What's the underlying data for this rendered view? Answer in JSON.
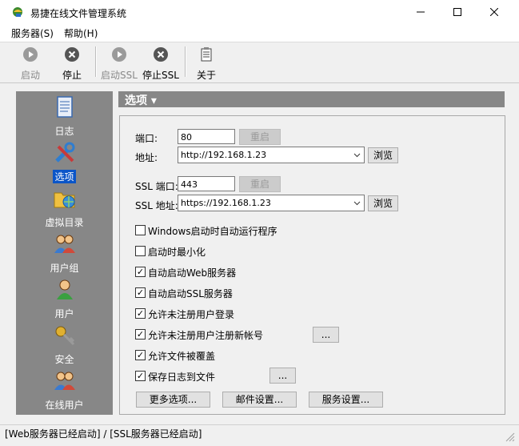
{
  "window": {
    "title": "易捷在线文件管理系统"
  },
  "menu": {
    "items": [
      {
        "label": "服务器(S)"
      },
      {
        "label": "帮助(H)"
      }
    ]
  },
  "toolbar": {
    "start": "启动",
    "stop": "停止",
    "start_ssl": "启动SSL",
    "stop_ssl": "停止SSL",
    "about": "关于"
  },
  "nav": {
    "items": [
      {
        "label": "日志"
      },
      {
        "label": "选项",
        "selected": true
      },
      {
        "label": "虚拟目录"
      },
      {
        "label": "用户组"
      },
      {
        "label": "用户"
      },
      {
        "label": "安全"
      },
      {
        "label": "在线用户"
      }
    ]
  },
  "options": {
    "header": "选项 ▾",
    "port_label": "端口:",
    "port_value": "80",
    "restart": "重启",
    "address_label": "地址:",
    "address_value": "http://192.168.1.23",
    "browse": "浏览",
    "ssl_port_label": "SSL 端口:",
    "ssl_port_value": "443",
    "ssl_address_label": "SSL 地址:",
    "ssl_address_value": "https://192.168.1.23",
    "checkboxes": [
      {
        "label": "Windows启动时自动运行程序",
        "checked": false
      },
      {
        "label": "启动时最小化",
        "checked": false
      },
      {
        "label": "自动启动Web服务器",
        "checked": true
      },
      {
        "label": "自动启动SSL服务器",
        "checked": true
      },
      {
        "label": "允许未注册用户登录",
        "checked": true
      },
      {
        "label": "允许未注册用户注册新帐号",
        "checked": true
      },
      {
        "label": "允许文件被覆盖",
        "checked": true
      },
      {
        "label": "保存日志到文件",
        "checked": true
      }
    ],
    "ellipsis": "...",
    "more_options": "更多选项...",
    "mail_settings": "邮件设置...",
    "service_settings": "服务设置..."
  },
  "status": {
    "text": "[Web服务器已经启动] / [SSL服务器已经启动]"
  }
}
